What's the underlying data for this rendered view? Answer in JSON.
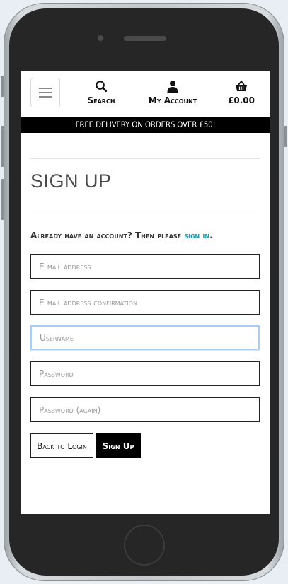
{
  "header": {
    "menu_icon": "hamburger-icon",
    "search": {
      "icon": "search-icon",
      "label": "Search"
    },
    "account": {
      "icon": "user-icon",
      "label": "My Account"
    },
    "cart": {
      "icon": "basket-icon",
      "total": "£0.00"
    }
  },
  "banner": {
    "text": "FREE DELIVERY ON ORDERS OVER £50!"
  },
  "page": {
    "title": "SIGN UP",
    "account_prompt": "Already have an account? Then please ",
    "sign_in_link": "sign in",
    "sign_in_suffix": ".",
    "link_color": "#1d9cb3"
  },
  "form": {
    "email": {
      "placeholder": "E-mail address",
      "value": ""
    },
    "email_confirm": {
      "placeholder": "E-mail address confirmation",
      "value": ""
    },
    "username": {
      "placeholder": "Username",
      "value": ""
    },
    "password": {
      "placeholder": "Password",
      "value": ""
    },
    "password_again": {
      "placeholder": "Password (again)",
      "value": ""
    },
    "back_button": "Back to Login",
    "signup_button": "Sign Up"
  }
}
